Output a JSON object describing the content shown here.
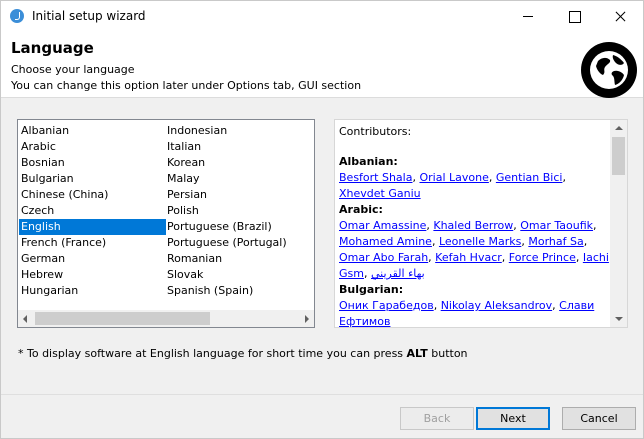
{
  "window": {
    "title": "Initial setup wizard"
  },
  "header": {
    "title": "Language",
    "subtitle": "Choose your language",
    "note": "You can change this option later under Options tab, GUI section"
  },
  "languages": {
    "column1": [
      "Albanian",
      "Arabic",
      "Bosnian",
      "Bulgarian",
      "Chinese (China)",
      "Czech",
      "English",
      "French (France)",
      "German",
      "Hebrew",
      "Hungarian"
    ],
    "column2": [
      "Indonesian",
      "Italian",
      "Korean",
      "Malay",
      "Persian",
      "Polish",
      "Portuguese (Brazil)",
      "Portuguese (Portugal)",
      "Romanian",
      "Slovak",
      "Spanish (Spain)"
    ],
    "selected": "English"
  },
  "contributors": {
    "title": "Contributors:",
    "groups": [
      {
        "language": "Albanian:",
        "names": [
          "Besfort Shala",
          "Orial Lavone",
          "Gentian Bici",
          "Xhevdet Ganiu"
        ]
      },
      {
        "language": "Arabic:",
        "names": [
          "Omar Amassine",
          "Khaled Berrow",
          "Omar Taoufik",
          "Mohamed Amine",
          "Leonelle Marks",
          "Morhaf Sa",
          "Omar Abo Farah",
          "Kefah Hvacr",
          "Force Prince",
          "Iachi Gsm",
          "بهاء القريني"
        ]
      },
      {
        "language": "Bulgarian:",
        "names": [
          "Оник Гарабедов",
          "Nikolay Aleksandrov",
          "Слави Ефтимов"
        ]
      }
    ]
  },
  "footnote": {
    "prefix": "* To display software at English language for short time you can press ",
    "key": "ALT",
    "suffix": " button"
  },
  "buttons": {
    "back": "Back",
    "next": "Next",
    "cancel": "Cancel"
  },
  "colors": {
    "selection": "#0078d7",
    "link": "#0000ff"
  },
  "icons": {
    "app": "app-icon",
    "globe": "globe-icon"
  }
}
